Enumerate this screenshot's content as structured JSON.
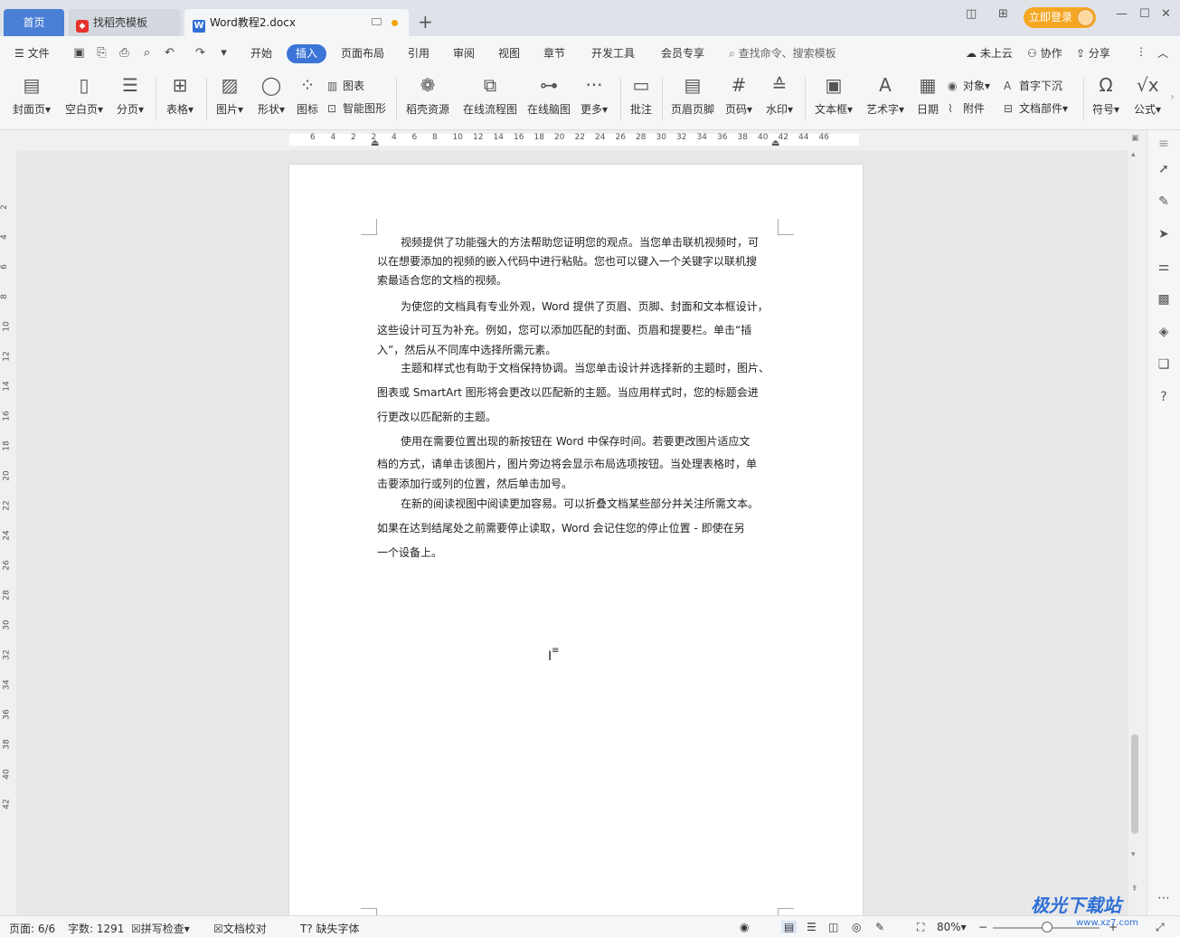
{
  "tabs": {
    "home": "首页",
    "template": "找稻壳模板",
    "document": "Word教程2.docx",
    "login": "立即登录"
  },
  "menu": {
    "file": "文件",
    "items": [
      "开始",
      "插入",
      "页面布局",
      "引用",
      "审阅",
      "视图",
      "章节",
      "开发工具",
      "会员专享"
    ],
    "search_placeholder": "查找命令、搜索模板",
    "cloud": "未上云",
    "collab": "协作",
    "share": "分享"
  },
  "ribbon": {
    "cover": "封面页",
    "blank": "空白页",
    "pagebreak": "分页",
    "table": "表格",
    "picture": "图片",
    "shape": "形状",
    "icon": "图标",
    "chart": "图表",
    "smartart": "智能图形",
    "resource": "稻壳资源",
    "flowchart": "在线流程图",
    "mindmap": "在线脑图",
    "more": "更多",
    "comment": "批注",
    "header_footer": "页眉页脚",
    "page_number": "页码",
    "watermark": "水印",
    "textbox": "文本框",
    "wordart": "艺术字",
    "date": "日期",
    "object": "对象",
    "attachment": "附件",
    "dropcap": "首字下沉",
    "doc_parts": "文档部件",
    "symbol": "符号",
    "formula": "公式"
  },
  "ruler": {
    "h_ticks": [
      "6",
      "4",
      "2",
      "2",
      "4",
      "6",
      "8",
      "10",
      "12",
      "14",
      "16",
      "18",
      "20",
      "22",
      "24",
      "26",
      "28",
      "30",
      "32",
      "34",
      "36",
      "38",
      "40",
      "42",
      "44",
      "46"
    ],
    "v_ticks": [
      "2",
      "4",
      "6",
      "8",
      "10",
      "12",
      "14",
      "16",
      "18",
      "20",
      "22",
      "24",
      "26",
      "28",
      "30",
      "32",
      "34",
      "36",
      "38",
      "40",
      "42"
    ]
  },
  "document": {
    "paragraphs": [
      [
        "视频提供了功能强大的方法帮助您证明您的观点。当您单击联机视频时，可",
        "以在想要添加的视频的嵌入代码中进行粘贴。您也可以键入一个关键字以联机搜",
        "索最适合您的文档的视频。"
      ],
      [
        "为使您的文档具有专业外观，Word 提供了页眉、页脚、封面和文本框设计，",
        "这些设计可互为补充。例如，您可以添加匹配的封面、页眉和提要栏。单击“插",
        "入”，然后从不同库中选择所需元素。"
      ],
      [
        "主题和样式也有助于文档保持协调。当您单击设计并选择新的主题时，图片、",
        "图表或 SmartArt 图形将会更改以匹配新的主题。当应用样式时，您的标题会进",
        "行更改以匹配新的主题。"
      ],
      [
        "使用在需要位置出现的新按钮在 Word 中保存时间。若要更改图片适应文",
        "档的方式，请单击该图片，图片旁边将会显示布局选项按钮。当处理表格时，单",
        "击要添加行或列的位置，然后单击加号。"
      ],
      [
        "在新的阅读视图中阅读更加容易。可以折叠文档某些部分并关注所需文本。",
        "如果在达到结尾处之前需要停止读取，Word 会记住您的停止位置 - 即使在另",
        "一个设备上。"
      ]
    ]
  },
  "status": {
    "page": "页面: 6/6",
    "words": "字数: 1291",
    "spell": "拼写检查",
    "proof": "文档校对",
    "missing_font": "缺失字体",
    "zoom": "80%"
  },
  "watermark": {
    "brand": "极光下载站",
    "url": "www.xz7.com"
  },
  "colors": {
    "accent": "#3b75d8",
    "login": "#f5a623"
  }
}
